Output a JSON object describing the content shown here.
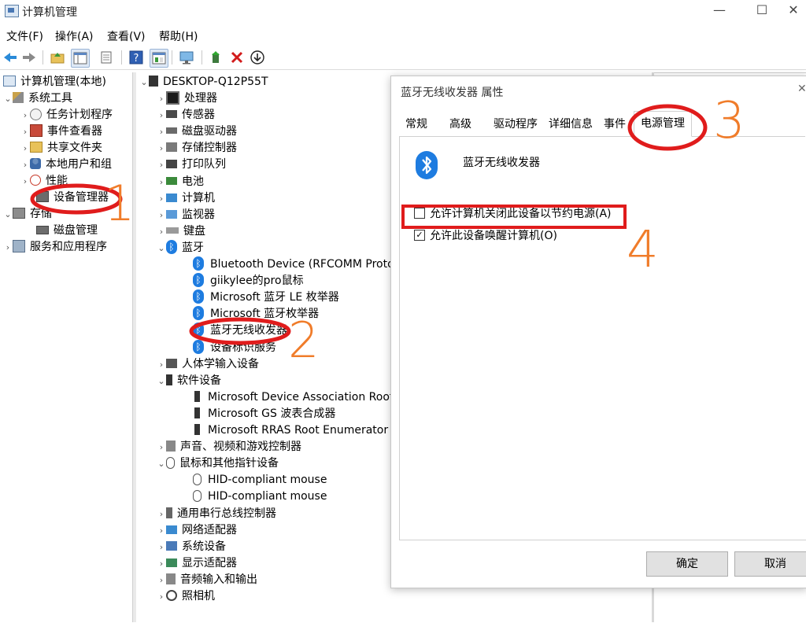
{
  "window": {
    "title": "计算机管理",
    "min": "—",
    "max": "☐",
    "close": "✕"
  },
  "menu": [
    "文件(F)",
    "操作(A)",
    "查看(V)",
    "帮助(H)"
  ],
  "toolbar": {
    "icons": [
      "back-arrow-icon",
      "forward-arrow-icon",
      "up-folder-icon",
      "show-tree-icon",
      "export-list-icon",
      "help-icon",
      "properties-icon",
      "monitor-icon",
      "update-driver-icon",
      "remove-device-icon",
      "download-icon"
    ]
  },
  "left_tree": {
    "root": "计算机管理(本地)",
    "system_tools": "系统工具",
    "task_scheduler": "任务计划程序",
    "event_viewer": "事件查看器",
    "shared_folders": "共享文件夹",
    "local_users": "本地用户和组",
    "performance": "性能",
    "device_manager": "设备管理器",
    "storage": "存储",
    "disk_management": "磁盘管理",
    "services": "服务和应用程序"
  },
  "device_tree": {
    "root": "DESKTOP-Q12P55T",
    "items": [
      {
        "label": "处理器",
        "expanded": false
      },
      {
        "label": "传感器",
        "expanded": false
      },
      {
        "label": "磁盘驱动器",
        "expanded": false
      },
      {
        "label": "存储控制器",
        "expanded": false
      },
      {
        "label": "打印队列",
        "expanded": false
      },
      {
        "label": "电池",
        "expanded": false
      },
      {
        "label": "计算机",
        "expanded": false
      },
      {
        "label": "监视器",
        "expanded": false
      },
      {
        "label": "键盘",
        "expanded": false
      },
      {
        "label": "蓝牙",
        "expanded": true
      }
    ],
    "bluetooth_children": [
      "Bluetooth Device (RFCOMM Protoco",
      "giikylee的pro鼠标",
      "Microsoft 蓝牙 LE 枚举器",
      "Microsoft 蓝牙枚举器",
      "蓝牙无线收发器",
      "设备标识服务"
    ],
    "hid": "人体学输入设备",
    "software_devices": "软件设备",
    "software_children": [
      "Microsoft Device Association Root E",
      "Microsoft GS 波表合成器",
      "Microsoft RRAS Root Enumerator"
    ],
    "sound": "声音、视频和游戏控制器",
    "mice": "鼠标和其他指针设备",
    "mice_children": [
      "HID-compliant mouse",
      "HID-compliant mouse"
    ],
    "usb": "通用串行总线控制器",
    "network": "网络适配器",
    "system": "系统设备",
    "display": "显示适配器",
    "audio_io": "音频输入和输出",
    "camera": "照相机"
  },
  "dialog": {
    "title": "蓝牙无线收发器 属性",
    "close": "✕",
    "tabs": [
      "常规",
      "高级",
      "驱动程序",
      "详细信息",
      "事件",
      "电源管理"
    ],
    "active_tab": "电源管理",
    "device_name": "蓝牙无线收发器",
    "option_allow_off": "允许计算机关闭此设备以节约电源(A)",
    "option_allow_off_checked": false,
    "option_wake": "允许此设备唤醒计算机(O)",
    "option_wake_checked": true,
    "ok": "确定",
    "cancel": "取消"
  },
  "annotations": {
    "n1": "1",
    "n2": "2",
    "n3": "3",
    "n4": "4",
    "annotation_color": "#e01c1c",
    "number_color": "#f07c2a"
  },
  "colors": {
    "bluetooth_blue": "#1e7ce0"
  }
}
